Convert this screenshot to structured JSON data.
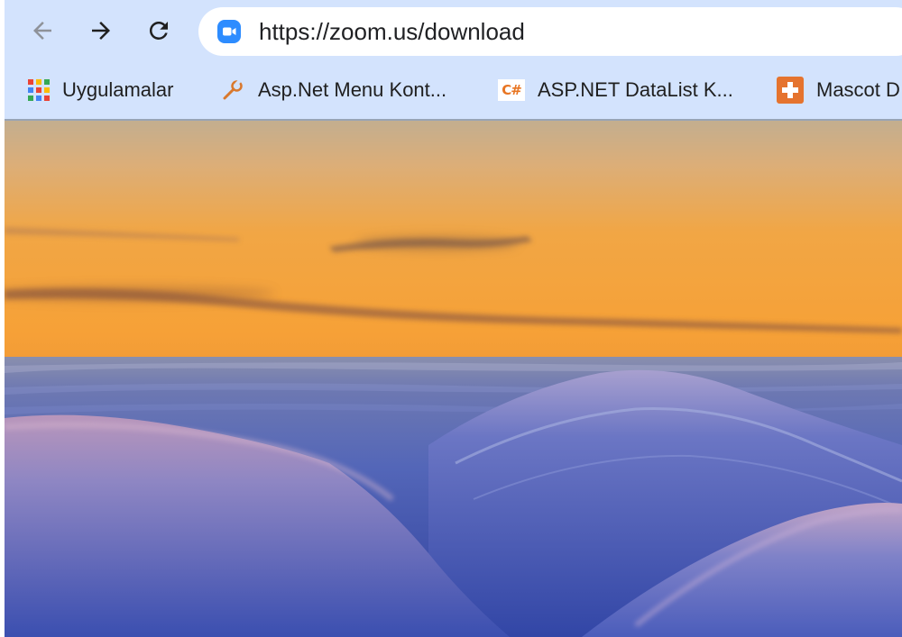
{
  "browser": {
    "toolbar": {
      "back_icon": "arrow-left-icon",
      "forward_icon": "arrow-right-icon",
      "reload_icon": "reload-icon",
      "url": "https://zoom.us/download",
      "site_icon": "zoom-favicon",
      "site_icon_color": "#2d8cff"
    },
    "bookmarks": [
      {
        "label": "Uygulamalar",
        "icon": "apps-grid-icon"
      },
      {
        "label": "Asp.Net Menu Kont...",
        "icon": "wrench-icon"
      },
      {
        "label": "ASP.NET DataList K...",
        "icon": "csharp-icon",
        "icon_text": "C#"
      },
      {
        "label": "Mascot D",
        "icon": "plus-cross-icon"
      }
    ]
  },
  "page": {
    "image": "sunset-sky-over-blue-wavy-sand-dunes",
    "colors": {
      "toolbar_bg": "#d3e3fd",
      "sky_top": "#c6b08f",
      "sky_horizon": "#f4a33c",
      "dunes": "#4657b4"
    }
  }
}
